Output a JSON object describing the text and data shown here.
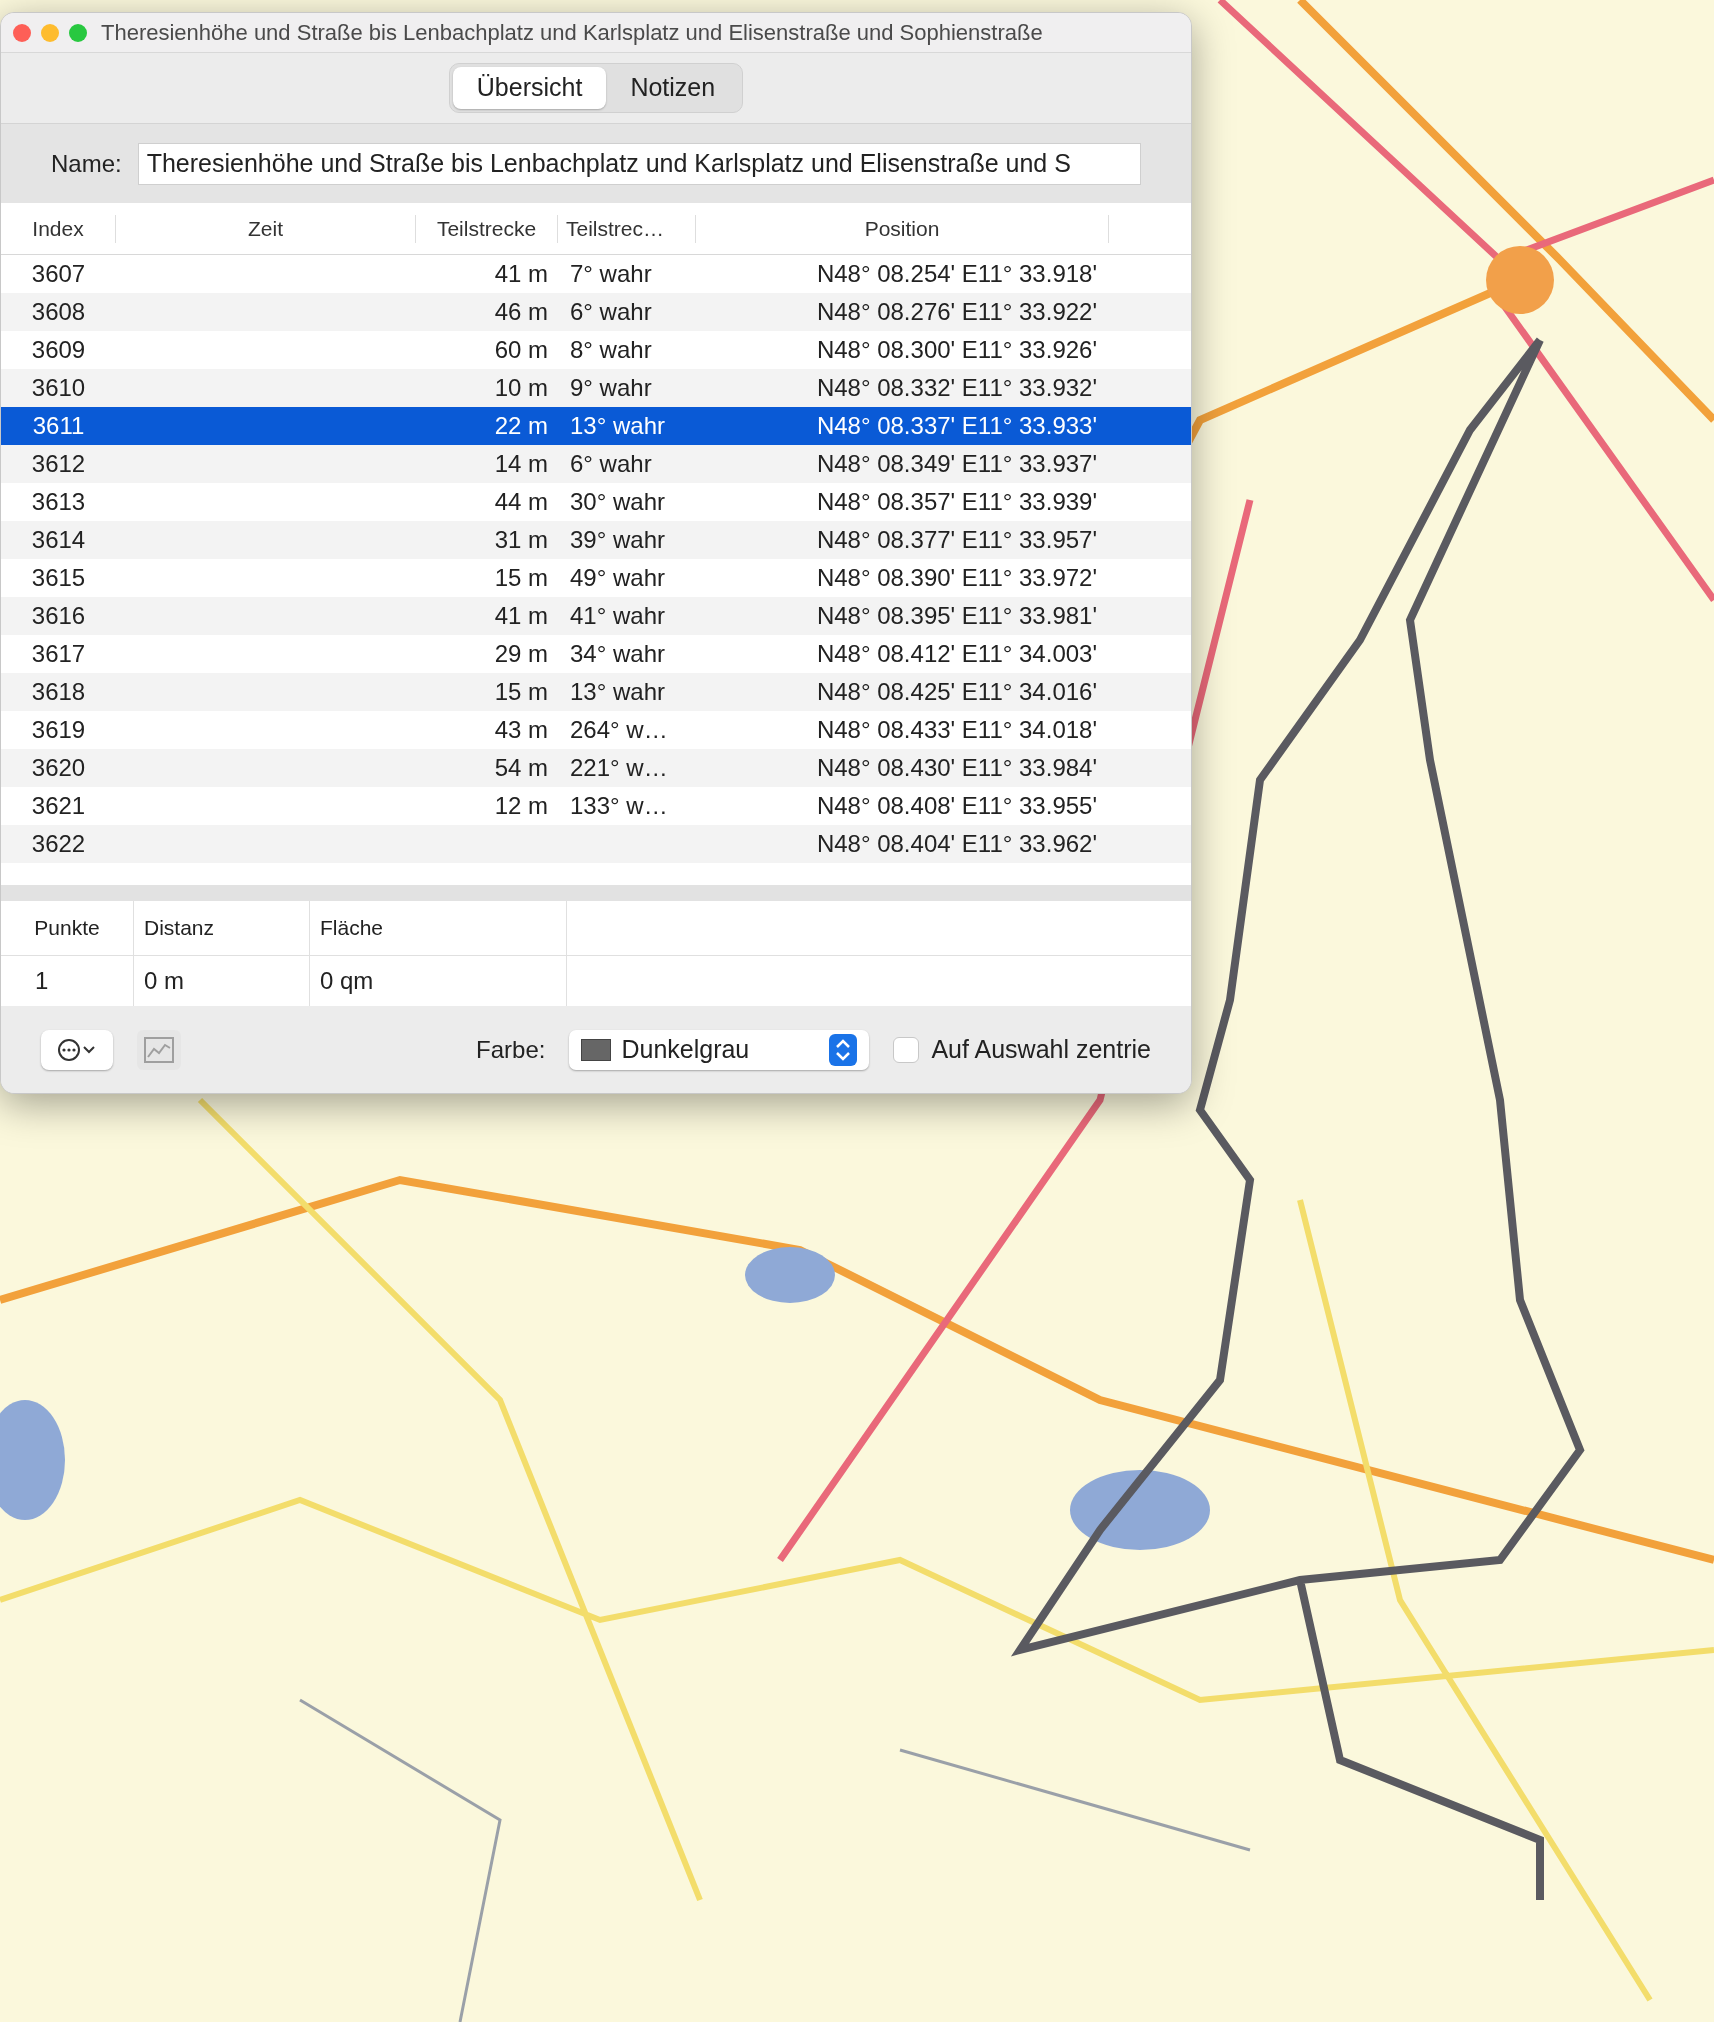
{
  "window": {
    "title": "Theresienhöhe und Straße bis Lenbachplatz und Karlsplatz und Elisenstraße und Sophienstraße"
  },
  "tabs": [
    {
      "label": "Übersicht",
      "selected": true
    },
    {
      "label": "Notizen",
      "selected": false
    }
  ],
  "name_field": {
    "label": "Name:",
    "value": "Theresienhöhe und Straße bis Lenbachplatz und Karlsplatz und Elisenstraße und S"
  },
  "table": {
    "columns": [
      "Index",
      "Zeit",
      "Teilstrecke",
      "Teilstrec…",
      "Position"
    ],
    "rows": [
      {
        "index": "3607",
        "distance": "41 m",
        "bearing": "7° wahr",
        "position": "N48° 08.254' E11° 33.918'",
        "selected": false
      },
      {
        "index": "3608",
        "distance": "46 m",
        "bearing": "6° wahr",
        "position": "N48° 08.276' E11° 33.922'",
        "selected": false
      },
      {
        "index": "3609",
        "distance": "60 m",
        "bearing": "8° wahr",
        "position": "N48° 08.300' E11° 33.926'",
        "selected": false
      },
      {
        "index": "3610",
        "distance": "10 m",
        "bearing": "9° wahr",
        "position": "N48° 08.332' E11° 33.932'",
        "selected": false
      },
      {
        "index": "3611",
        "distance": "22 m",
        "bearing": "13° wahr",
        "position": "N48° 08.337' E11° 33.933'",
        "selected": true
      },
      {
        "index": "3612",
        "distance": "14 m",
        "bearing": "6° wahr",
        "position": "N48° 08.349' E11° 33.937'",
        "selected": false
      },
      {
        "index": "3613",
        "distance": "44 m",
        "bearing": "30° wahr",
        "position": "N48° 08.357' E11° 33.939'",
        "selected": false
      },
      {
        "index": "3614",
        "distance": "31 m",
        "bearing": "39° wahr",
        "position": "N48° 08.377' E11° 33.957'",
        "selected": false
      },
      {
        "index": "3615",
        "distance": "15 m",
        "bearing": "49° wahr",
        "position": "N48° 08.390' E11° 33.972'",
        "selected": false
      },
      {
        "index": "3616",
        "distance": "41 m",
        "bearing": "41° wahr",
        "position": "N48° 08.395' E11° 33.981'",
        "selected": false
      },
      {
        "index": "3617",
        "distance": "29 m",
        "bearing": "34° wahr",
        "position": "N48° 08.412' E11° 34.003'",
        "selected": false
      },
      {
        "index": "3618",
        "distance": "15 m",
        "bearing": "13° wahr",
        "position": "N48° 08.425' E11° 34.016'",
        "selected": false
      },
      {
        "index": "3619",
        "distance": "43 m",
        "bearing": "264° w…",
        "position": "N48° 08.433' E11° 34.018'",
        "selected": false
      },
      {
        "index": "3620",
        "distance": "54 m",
        "bearing": "221° w…",
        "position": "N48° 08.430' E11° 33.984'",
        "selected": false
      },
      {
        "index": "3621",
        "distance": "12 m",
        "bearing": "133° w…",
        "position": "N48° 08.408' E11° 33.955'",
        "selected": false
      },
      {
        "index": "3622",
        "position": "N48° 08.404' E11° 33.962'",
        "selected": false
      }
    ]
  },
  "stats": {
    "columns": [
      "Punkte",
      "Distanz",
      "Fläche"
    ],
    "values": [
      "1",
      "0 m",
      "0 qm"
    ]
  },
  "toolbar": {
    "chart_button": {
      "disabled": true
    },
    "color_label": "Farbe:",
    "color_value": "Dunkelgrau",
    "center_checkbox": {
      "label": "Auf Auswahl zentrie",
      "checked": false
    }
  }
}
